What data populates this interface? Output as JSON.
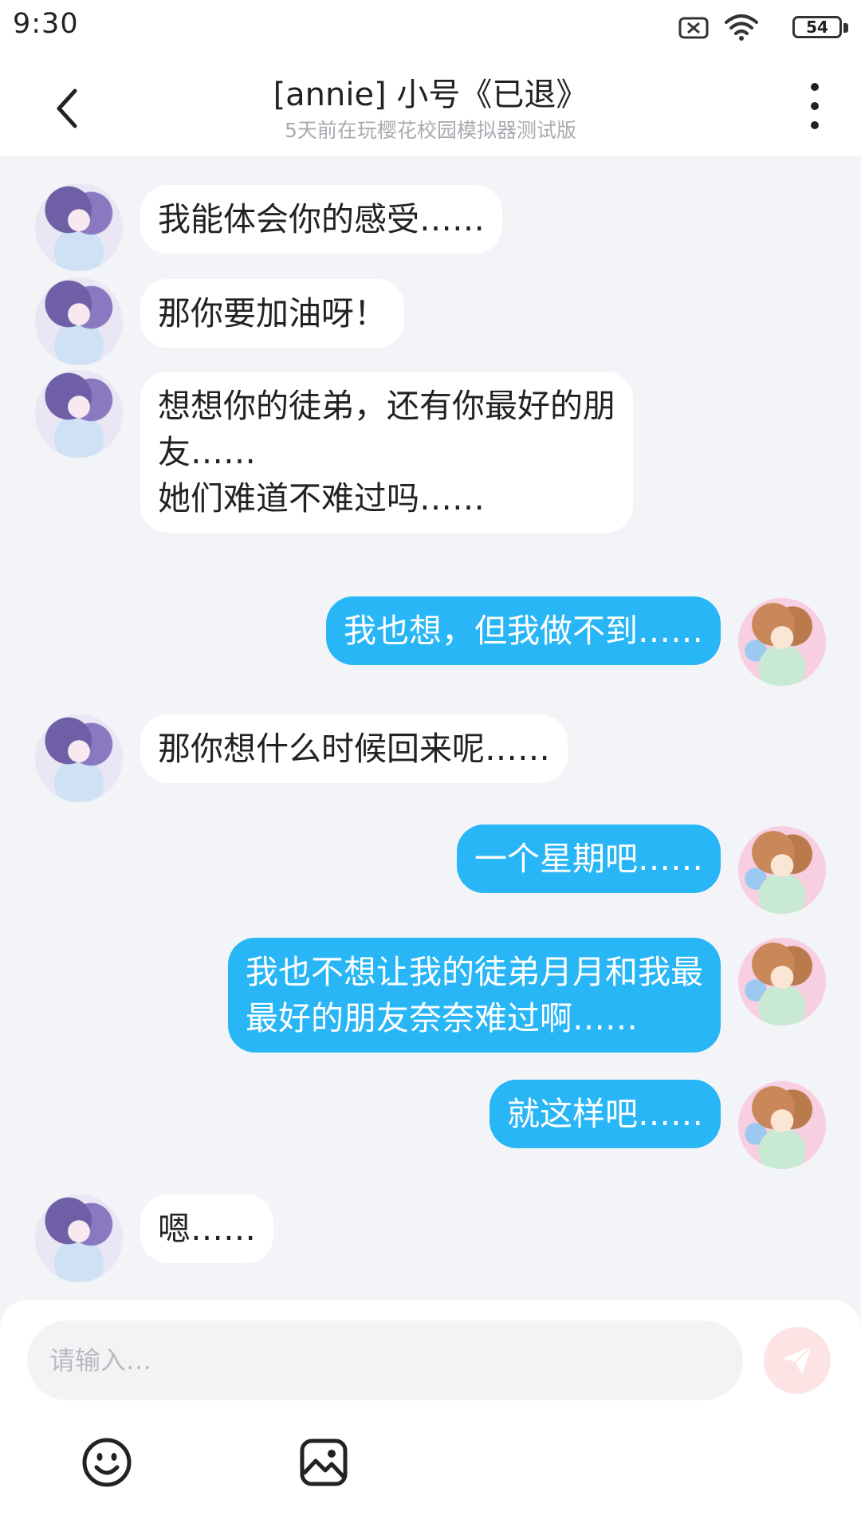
{
  "status_bar": {
    "time": "9:30",
    "battery": "54",
    "icons": [
      "sim-off-icon",
      "wifi-icon",
      "battery-icon"
    ]
  },
  "header": {
    "title": "[annie] 小号《已退》",
    "subtitle": "5天前在玩樱花校园模拟器测试版",
    "back_icon": "chevron-left-icon",
    "more_icon": "more-vertical-icon"
  },
  "messages": [
    {
      "sender": "other",
      "text": "我能体会你的感受……"
    },
    {
      "sender": "other",
      "text": "那你要加油呀！"
    },
    {
      "sender": "other",
      "text": "想想你的徒弟，还有你最好的朋\n友……\n她们难道不难过吗……"
    },
    {
      "sender": "me",
      "text": "我也想，但我做不到……"
    },
    {
      "sender": "other",
      "text": "那你想什么时候回来呢……"
    },
    {
      "sender": "me",
      "text": "一个星期吧……"
    },
    {
      "sender": "me",
      "text": "我也不想让我的徒弟月月和我最\n最好的朋友奈奈难过啊……"
    },
    {
      "sender": "me",
      "text": "就这样吧……"
    },
    {
      "sender": "other",
      "text": "嗯……"
    }
  ],
  "composer": {
    "placeholder": "请输入…",
    "send_icon": "send-icon",
    "emoji_icon": "emoji-icon",
    "image_icon": "image-icon"
  },
  "colors": {
    "my_bubble": "#29b6f6",
    "other_bubble": "#ffffff",
    "chat_background": "#f3f4f7",
    "send_button": "#fde3e4"
  }
}
